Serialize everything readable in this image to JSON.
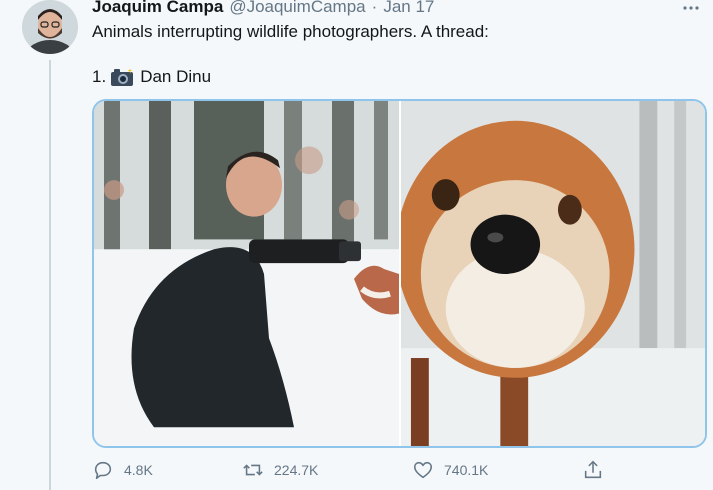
{
  "tweet": {
    "author_name": "Joaquim Campa",
    "author_handle": "@JoaquimCampa",
    "separator": "·",
    "date": "Jan 17",
    "text": "Animals interrupting wildlife photographers. A thread:",
    "item_number": "1.",
    "item_emoji": "camera-with-flash-icon",
    "item_credit": "Dan Dinu",
    "more_icon": "ellipsis-icon"
  },
  "media": [
    {
      "description_icon": "photographer-with-fox-photo"
    },
    {
      "description_icon": "fox-closeup-photo"
    }
  ],
  "actions": {
    "reply_count": "4.8K",
    "retweet_count": "224.7K",
    "like_count": "740.1K"
  },
  "colors": {
    "accent": "#1da1f2",
    "media_border": "#8fc5ea",
    "muted_text": "#657786",
    "background": "#f5f8fa"
  }
}
